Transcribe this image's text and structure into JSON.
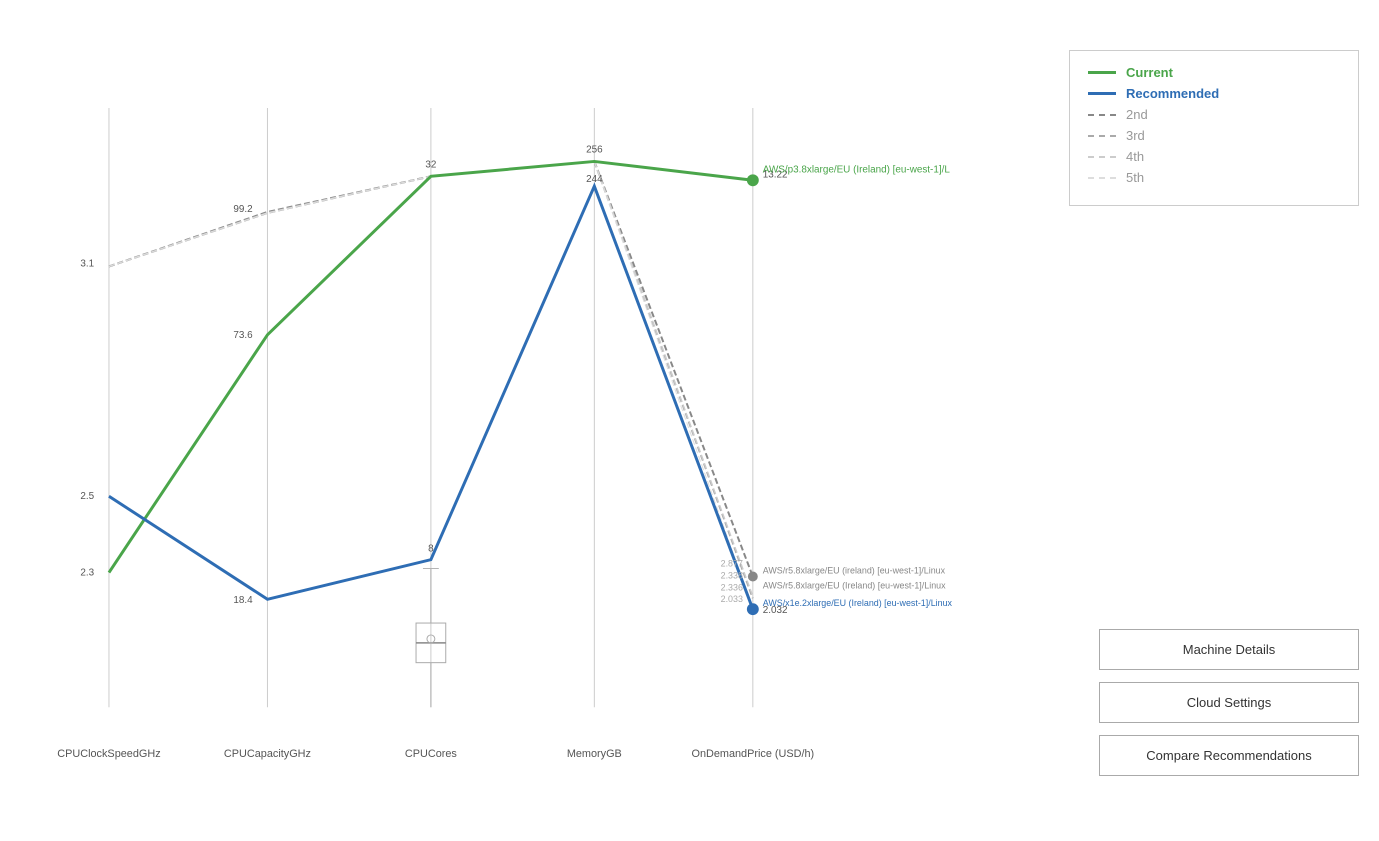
{
  "legend": {
    "items": [
      {
        "id": "current",
        "label": "Current",
        "color": "#4aa54a",
        "dash": "none",
        "width": 3
      },
      {
        "id": "recommended",
        "label": "Recommended",
        "color": "#2e6db4",
        "dash": "none",
        "width": 3
      },
      {
        "id": "2nd",
        "label": "2nd",
        "color": "#999999",
        "dash": "6,3",
        "width": 2
      },
      {
        "id": "3rd",
        "label": "3rd",
        "color": "#bbbbbb",
        "dash": "6,3",
        "width": 2
      },
      {
        "id": "4th",
        "label": "4th",
        "color": "#cccccc",
        "dash": "6,3",
        "width": 1
      },
      {
        "id": "5th",
        "label": "5th",
        "color": "#dddddd",
        "dash": "6,3",
        "width": 1
      }
    ]
  },
  "axes": [
    {
      "id": "cpu-clock",
      "label": "CPUClockSpeedGHz",
      "x_pos": 110
    },
    {
      "id": "cpu-capacity",
      "label": "CPUCapacityGHz",
      "x_pos": 270
    },
    {
      "id": "cpu-cores",
      "label": "CPUCores",
      "x_pos": 435
    },
    {
      "id": "memory",
      "label": "MemoryGB",
      "x_pos": 600
    },
    {
      "id": "price",
      "label": "OnDemandPrice (USD/h)",
      "x_pos": 760
    }
  ],
  "series": {
    "current": {
      "label": "Current",
      "color": "#4aa54a",
      "points": [
        {
          "axis": "cpu-clock",
          "value": 2.3
        },
        {
          "axis": "cpu-capacity",
          "value": 73.6
        },
        {
          "axis": "cpu-cores",
          "value": 32
        },
        {
          "axis": "memory",
          "value": 256
        },
        {
          "axis": "price",
          "value": 13.22
        }
      ],
      "instance_label": "AWS/p3.8xlarge/EU (Ireland) [eu-west-1]/L"
    },
    "recommended": {
      "label": "Recommended",
      "color": "#2e6db4",
      "points": [
        {
          "axis": "cpu-clock",
          "value": 2.5
        },
        {
          "axis": "cpu-capacity",
          "value": 18.4
        },
        {
          "axis": "cpu-cores",
          "value": 8
        },
        {
          "axis": "memory",
          "value": 244
        },
        {
          "axis": "price",
          "value": 2.032
        }
      ],
      "instance_label": "AWS/x1e.2xlarge/EU (Ireland) [eu-west-1]/Linux"
    },
    "second": {
      "label": "2nd",
      "color": "#888888",
      "points": [
        {
          "axis": "cpu-clock",
          "value": 3.1
        },
        {
          "axis": "cpu-capacity",
          "value": 99.2
        },
        {
          "axis": "cpu-cores",
          "value": 32
        },
        {
          "axis": "memory",
          "value": 256
        },
        {
          "axis": "price",
          "value": 2.877
        }
      ],
      "instance_label": "AWS/r5.8xlarge/EU (Ireland) [eu-west-1]/Linux"
    },
    "third": {
      "label": "3rd",
      "color": "#aaaaaa",
      "points": [
        {
          "axis": "cpu-clock",
          "value": 3.1
        },
        {
          "axis": "cpu-capacity",
          "value": 99
        },
        {
          "axis": "cpu-cores",
          "value": 32
        },
        {
          "axis": "memory",
          "value": 256
        },
        {
          "axis": "price",
          "value": 2.336
        }
      ]
    }
  },
  "data_labels": {
    "current": [
      "2.3",
      "73.6",
      "32",
      "256",
      "13.22"
    ],
    "recommended": [
      "2.5",
      "18.4",
      "8",
      "244",
      "2.032"
    ],
    "second_top": [
      "3.1",
      "99.2",
      "32",
      "256"
    ],
    "second_price": "2.877",
    "third_price": "2.336",
    "fourth_price": "2.338",
    "fifth_price": "2.033"
  },
  "buttons": [
    {
      "id": "machine-details",
      "label": "Machine Details"
    },
    {
      "id": "cloud-settings",
      "label": "Cloud Settings"
    },
    {
      "id": "compare-recommendations",
      "label": "Compare Recommendations"
    }
  ],
  "instance_labels": {
    "current_short": "AWS/p3.8xlarge/EU (Ireland) [eu-west-1]/L",
    "recommended_full": "AWS/x1e.2xlarge/EU (Ireland) [eu-west-1]/Linux",
    "second_full": "AWS/r5.8xlarge/EU (Ireland) [eu-west-1]/Linux",
    "third_full": "AWS/r5.8xlarge/EU (ireland) [eu-west-1]/Linux"
  }
}
